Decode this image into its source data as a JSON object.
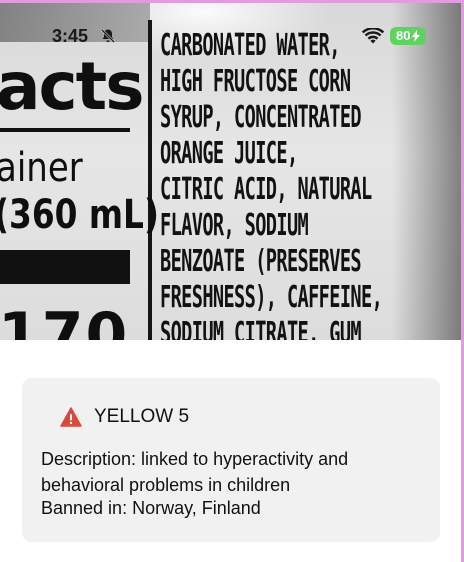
{
  "status_bar": {
    "time": "3:45",
    "battery": "80"
  },
  "photo": {
    "left_panel": [
      "acts",
      "ainer",
      "(360 mL)",
      "170"
    ],
    "ingredients": [
      "CARBONATED WATER,",
      "HIGH FRUCTOSE CORN",
      "SYRUP, CONCENTRATED",
      "ORANGE JUICE,",
      "CITRIC ACID, NATURAL",
      "FLAVOR, SODIUM",
      "BENZOATE (PRESERVES",
      "FRESHNESS), CAFFEINE,",
      "SODIUM CITRATE, GUM"
    ]
  },
  "result_card": {
    "icon": "warning-icon",
    "title": "YELLOW 5",
    "description": "Description: linked to hyperactivity and behavioral problems in children",
    "banned_in": "Banned in: Norway, Finland"
  },
  "colors": {
    "warning": "#d84a3a",
    "card_bg": "#f1f1f1",
    "battery": "#5fd35f",
    "frame": "#e39be0"
  }
}
